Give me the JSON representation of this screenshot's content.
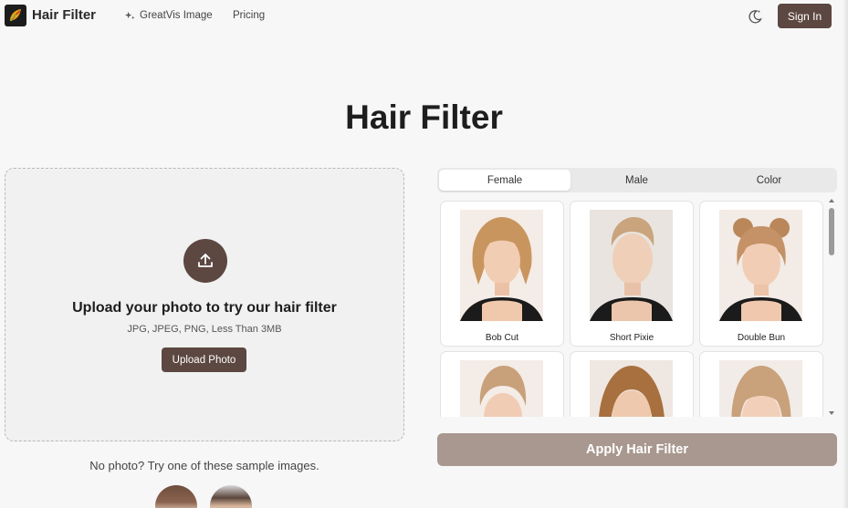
{
  "header": {
    "brand": "Hair Filter",
    "nav": [
      {
        "label": "GreatVis Image",
        "icon": "sparkles-icon"
      },
      {
        "label": "Pricing"
      }
    ],
    "theme_toggle_icon": "moon-stars-icon",
    "signin_label": "Sign In"
  },
  "page": {
    "title": "Hair Filter"
  },
  "upload": {
    "icon": "upload-icon",
    "heading": "Upload your photo to try our hair filter",
    "formats": "JPG, JPEG, PNG, Less Than 3MB",
    "button_label": "Upload Photo"
  },
  "samples": {
    "text": "No photo? Try one of these sample images."
  },
  "tabs": {
    "items": [
      "Female",
      "Male",
      "Color"
    ],
    "selected": "Female"
  },
  "styles": [
    {
      "label": "Bob Cut"
    },
    {
      "label": "Short Pixie"
    },
    {
      "label": "Double Bun"
    },
    {
      "label": ""
    },
    {
      "label": ""
    },
    {
      "label": ""
    }
  ],
  "apply_button": {
    "label": "Apply Hair Filter"
  },
  "colors": {
    "accent": "#5c4741",
    "apply_disabled": "#a8988f",
    "background": "#f7f7f7"
  }
}
